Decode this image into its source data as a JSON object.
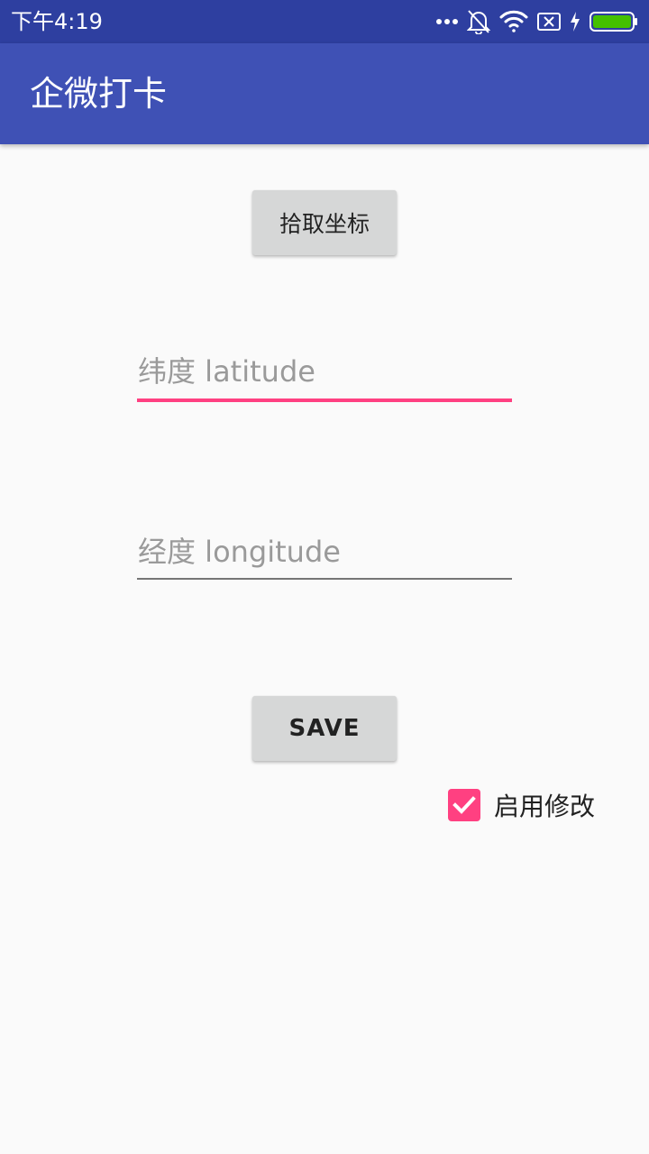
{
  "status_bar": {
    "time": "下午4:19",
    "icons": [
      "more-dots-icon",
      "notifications-off-icon",
      "wifi-icon",
      "sim-disabled-icon",
      "charging-bolt-icon",
      "battery-icon"
    ],
    "battery_color": "#44c000"
  },
  "app_bar": {
    "title": "企微打卡",
    "color": "#3f51b5"
  },
  "main": {
    "pick_button_label": "拾取坐标",
    "latitude": {
      "value": "",
      "placeholder": "纬度 latitude"
    },
    "longitude": {
      "value": "",
      "placeholder": "经度 longitude"
    },
    "save_button_label": "SAVE",
    "enable_checkbox": {
      "label": "启用修改",
      "checked": true
    }
  },
  "colors": {
    "accent": "#ff4081",
    "primary": "#3f51b5",
    "primary_dark": "#2e3fa0",
    "background": "#fafafa"
  }
}
